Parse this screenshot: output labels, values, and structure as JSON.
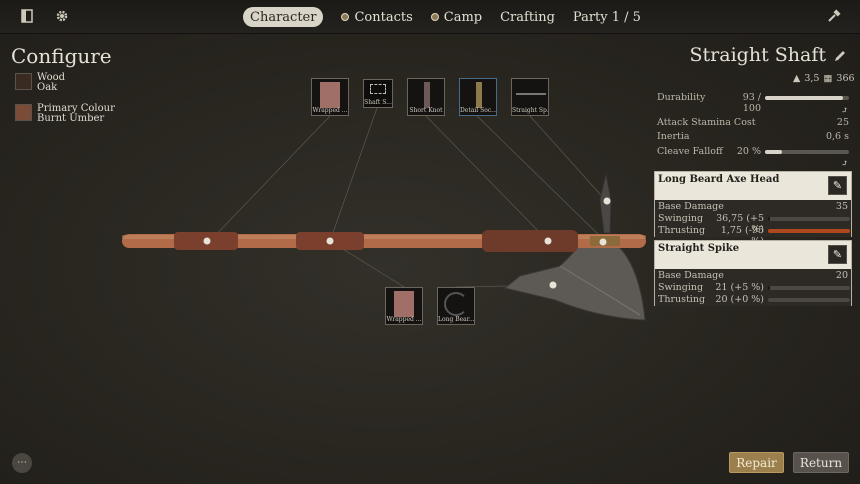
{
  "nav": {
    "tabs": [
      {
        "label": "Character",
        "active": true
      },
      {
        "label": "Contacts",
        "icon": "dot-icon"
      },
      {
        "label": "Camp",
        "icon": "dot-icon"
      },
      {
        "label": "Crafting"
      },
      {
        "label": "Party 1 / 5"
      }
    ]
  },
  "configure": {
    "title": "Configure",
    "materials": [
      {
        "label": "Wood",
        "value": "Oak",
        "color": "#3a2b22"
      },
      {
        "label": "Primary Colour",
        "value": "Burnt Umber",
        "color": "#7a4b36"
      }
    ]
  },
  "parts": {
    "top": [
      "Wrapped ...",
      "Shaft S...",
      "Short Knot",
      "Detail Soc...",
      "Straight Sp..."
    ],
    "bottom": [
      "Wrapped ...",
      "Long Bear..."
    ]
  },
  "panel": {
    "title": "Straight Shaft",
    "weight": "3,5",
    "value": "366",
    "durability_label": "Durability",
    "durability_value": "93 / 100",
    "durability_fraction": 0.93,
    "attack_stamina_label": "Attack Stamina Cost",
    "attack_stamina_value": "25",
    "inertia_label": "Inertia",
    "inertia_value": "0,6 s",
    "cleave_label": "Cleave Falloff",
    "cleave_value": "20 %",
    "cleave_fraction": 0.2
  },
  "cards": [
    {
      "title": "Long Beard Axe Head",
      "base_damage_label": "Base Damage",
      "base_damage": "35",
      "swinging_label": "Swinging",
      "swinging": "36,75 (+5 %)",
      "swinging_fraction": 0.02,
      "thrusting_label": "Thrusting",
      "thrusting": "1,75 (-95 %)",
      "thrusting_fraction": 1.0,
      "thrusting_color": "#b0481e"
    },
    {
      "title": "Straight Spike",
      "base_damage_label": "Base Damage",
      "base_damage": "20",
      "swinging_label": "Swinging",
      "swinging": "21 (+5 %)",
      "swinging_fraction": 0.02,
      "thrusting_label": "Thrusting",
      "thrusting": "20 (+0 %)",
      "thrusting_fraction": 0.0
    }
  ],
  "buttons": {
    "repair": "Repair",
    "return": "Return"
  }
}
